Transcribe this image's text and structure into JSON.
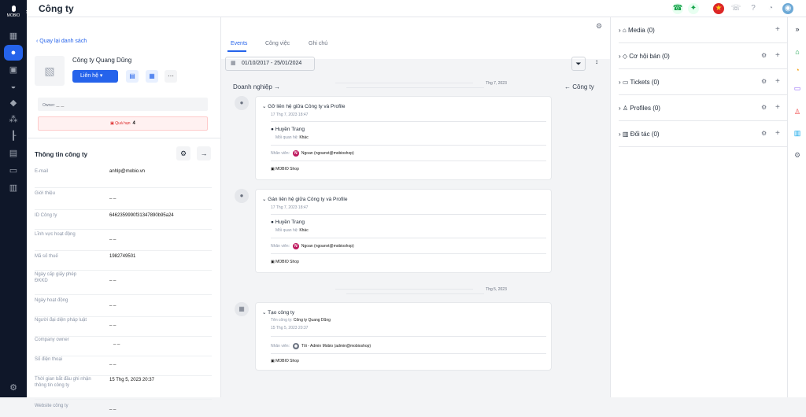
{
  "app": {
    "title": "Công ty",
    "logo_text": "MOBIO"
  },
  "left_panel": {
    "back_label": "Quay lại danh sách",
    "company_name": "Công ty Quang Dũng",
    "contact_button": "Liên hệ",
    "owner_label": "Owner:",
    "owner_value": "_ _",
    "overdue_label": "Quá hạn",
    "overdue_count": "4",
    "info_title": "Thông tin công ty",
    "fields": [
      {
        "label": "E-mail",
        "value": "anhlp@mobio.vn"
      },
      {
        "label": "Giới thiệu",
        "value": "_ _"
      },
      {
        "label": "ID Công ty",
        "value": "6462359990f31347890b95a24"
      },
      {
        "label": "Lĩnh vực hoạt động",
        "value": "_ _"
      },
      {
        "label": "Mã số thuế",
        "value": "1982749501"
      },
      {
        "label": "Ngày cấp giấy phép ĐKKD",
        "value": "_ _"
      },
      {
        "label": "Ngày hoạt động",
        "value": "_ _"
      },
      {
        "label": "Người đại diện pháp luật",
        "value": "_ _"
      },
      {
        "label": "Company owner",
        "value": "_ _"
      },
      {
        "label": "Số điện thoại",
        "value": "_ _"
      },
      {
        "label": "Thời gian bắt đầu ghi nhận thông tin công ty",
        "value": "15 Thg 5, 2023 20:37"
      },
      {
        "label": "Website công ty",
        "value": "_ _"
      }
    ]
  },
  "center": {
    "tabs": [
      "Events",
      "Công việc",
      "Ghi chú"
    ],
    "date_range": "01/10/2017 - 25/01/2024",
    "left_heading": "Doanh nghiệp",
    "right_heading": "Công ty",
    "months": [
      "Thg 7, 2023",
      "Thg 5, 2023"
    ],
    "events": [
      {
        "title": "Gỡ liên hệ giữa Công ty và Profile",
        "date": "17 Thg 7, 2023 18:47",
        "person": "Huyền Trang",
        "relation_label": "Mối quan hệ:",
        "relation": "Khác",
        "staff_label": "Nhân viên:",
        "staff_initial": "N",
        "staff": "Ngoan (ngoanvt@mobioshop)",
        "shop": "MOBIO Shop"
      },
      {
        "title": "Gán liên hệ giữa Công ty và Profile",
        "date": "17 Thg 7, 2023 18:47",
        "person": "Huyền Trang",
        "relation_label": "Mối quan hệ:",
        "relation": "Khác",
        "staff_label": "Nhân viên:",
        "staff_initial": "N",
        "staff": "Ngoan (ngoanvt@mobioshop)",
        "shop": "MOBIO Shop"
      },
      {
        "title": "Tạo công ty",
        "subtitle_label": "Tên công ty:",
        "subtitle": "Công ty Quang Dũng",
        "date": "15 Thg 5, 2023 20:37",
        "staff_label": "Nhân viên:",
        "staff": "Tôi - Admin Mobio (admin@mobioshop)",
        "shop": "MOBIO Shop"
      }
    ]
  },
  "right_panel": {
    "items": [
      {
        "label": "Media (0)",
        "icon": "media-icon"
      },
      {
        "label": "Cơ hội bán (0)",
        "icon": "cube-icon"
      },
      {
        "label": "Tickets (0)",
        "icon": "ticket-icon"
      },
      {
        "label": "Profiles (0)",
        "icon": "person-icon"
      },
      {
        "label": "Đối tác (0)",
        "icon": "building-icon"
      }
    ]
  }
}
